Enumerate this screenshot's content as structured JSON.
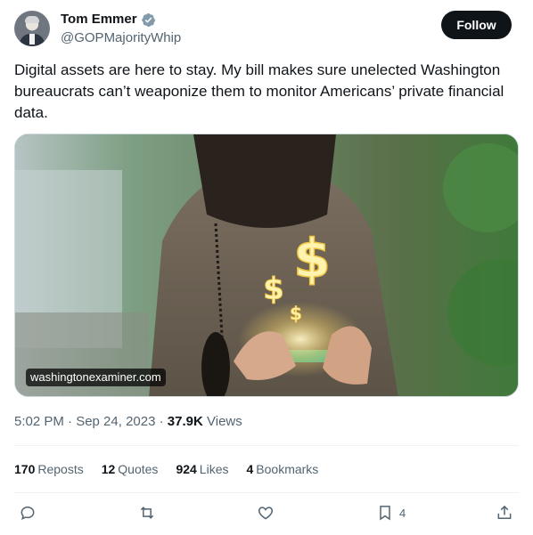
{
  "author": {
    "display_name": "Tom Emmer",
    "handle": "@GOPMajorityWhip",
    "verified": true
  },
  "follow_label": "Follow",
  "tweet": {
    "text": "Digital assets are here to stay. My bill makes sure unelected Washington bureaucrats can’t weaponize them to monitor Americans’ private financial data."
  },
  "media": {
    "source": "washingtonexaminer.com"
  },
  "meta": {
    "time": "5:02 PM",
    "separator": "·",
    "date": "Sep 24, 2023",
    "views_count": "37.9K",
    "views_label": "Views"
  },
  "stats": {
    "reposts": {
      "count": "170",
      "label": "Reposts"
    },
    "quotes": {
      "count": "12",
      "label": "Quotes"
    },
    "likes": {
      "count": "924",
      "label": "Likes"
    },
    "bookmarks": {
      "count": "4",
      "label": "Bookmarks"
    }
  },
  "actions": {
    "bookmark_count": "4"
  },
  "icons": {
    "verified": "verified-badge-icon",
    "reply": "reply-icon",
    "repost": "repost-icon",
    "like": "heart-icon",
    "bookmark": "bookmark-icon",
    "share": "share-icon"
  },
  "colors": {
    "text": "#0f1419",
    "secondary": "#536471",
    "verified": "#829aab",
    "follow_bg": "#0f1419",
    "divider": "#eff3f4"
  }
}
